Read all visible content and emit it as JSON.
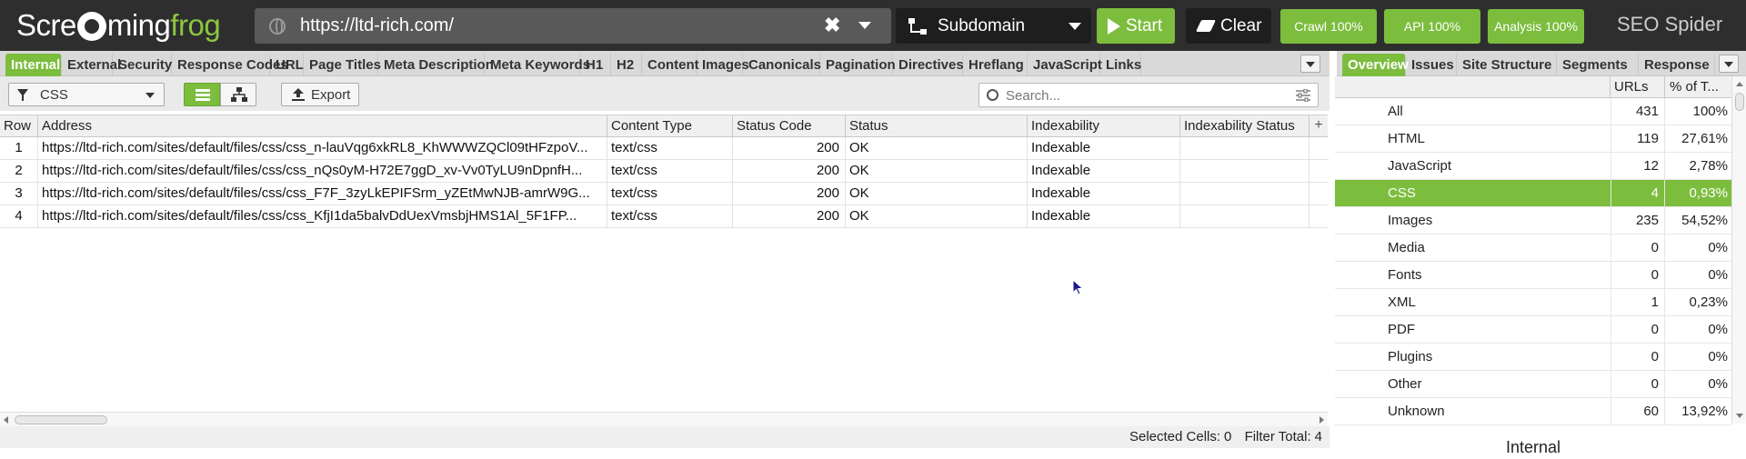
{
  "app": {
    "logo_part1": "Scre",
    "logo_part2": "ming",
    "logo_part3": "frog",
    "product": "SEO Spider",
    "accent_color": "#7cbd3e"
  },
  "topbar": {
    "url": "https://ltd-rich.com/",
    "mode": "Subdomain",
    "start_label": "Start",
    "clear_label": "Clear",
    "crawl_label": "Crawl 100%",
    "api_label": "API 100%",
    "analysis_label": "Analysis 100%"
  },
  "left_tabs": [
    "Internal",
    "External",
    "Security",
    "Response Codes",
    "URL",
    "Page Titles",
    "Meta Description",
    "Meta Keywords",
    "H1",
    "H2",
    "Content",
    "Images",
    "Canonicals",
    "Pagination",
    "Directives",
    "Hreflang",
    "JavaScript",
    "Links"
  ],
  "toolbar": {
    "filter_value": "CSS",
    "export_label": "Export",
    "search_placeholder": "Search..."
  },
  "table": {
    "columns": [
      "Row",
      "Address",
      "Content Type",
      "Status Code",
      "Status",
      "Indexability",
      "Indexability Status"
    ],
    "rows": [
      {
        "row": "1",
        "address": "https://ltd-rich.com/sites/default/files/css/css_n-lauVqg6xkRL8_KhWWWZQCl09tHFzpoV...",
        "content_type": "text/css",
        "status_code": "200",
        "status": "OK",
        "indexability": "Indexable",
        "indexability_status": ""
      },
      {
        "row": "2",
        "address": "https://ltd-rich.com/sites/default/files/css/css_nQs0yM-H72E7ggD_xv-Vv0TyLU9nDpnfH...",
        "content_type": "text/css",
        "status_code": "200",
        "status": "OK",
        "indexability": "Indexable",
        "indexability_status": ""
      },
      {
        "row": "3",
        "address": "https://ltd-rich.com/sites/default/files/css/css_F7F_3zyLkEPIFSrm_yZEtMwNJB-amrW9G...",
        "content_type": "text/css",
        "status_code": "200",
        "status": "OK",
        "indexability": "Indexable",
        "indexability_status": ""
      },
      {
        "row": "4",
        "address": "https://ltd-rich.com/sites/default/files/css/css_KfjI1da5balvDdUexVmsbjHMS1Al_5F1FP...",
        "content_type": "text/css",
        "status_code": "200",
        "status": "OK",
        "indexability": "Indexable",
        "indexability_status": ""
      }
    ]
  },
  "statusbar": {
    "selected_cells_label": "Selected Cells:",
    "selected_cells_value": "0",
    "filter_total_label": "Filter Total:",
    "filter_total_value": "4"
  },
  "right_tabs": [
    "Overview",
    "Issues",
    "Site Structure",
    "Segments",
    "Response"
  ],
  "overview": {
    "col_urls": "URLs",
    "col_pct": "% of T...",
    "rows": [
      {
        "label": "All",
        "urls": "431",
        "pct": "100%"
      },
      {
        "label": "HTML",
        "urls": "119",
        "pct": "27,61%"
      },
      {
        "label": "JavaScript",
        "urls": "12",
        "pct": "2,78%"
      },
      {
        "label": "CSS",
        "urls": "4",
        "pct": "0,93%",
        "selected": true
      },
      {
        "label": "Images",
        "urls": "235",
        "pct": "54,52%"
      },
      {
        "label": "Media",
        "urls": "0",
        "pct": "0%"
      },
      {
        "label": "Fonts",
        "urls": "0",
        "pct": "0%"
      },
      {
        "label": "XML",
        "urls": "1",
        "pct": "0,23%"
      },
      {
        "label": "PDF",
        "urls": "0",
        "pct": "0%"
      },
      {
        "label": "Plugins",
        "urls": "0",
        "pct": "0%"
      },
      {
        "label": "Other",
        "urls": "0",
        "pct": "0%"
      },
      {
        "label": "Unknown",
        "urls": "60",
        "pct": "13,92%"
      }
    ],
    "footer_title": "Internal"
  }
}
